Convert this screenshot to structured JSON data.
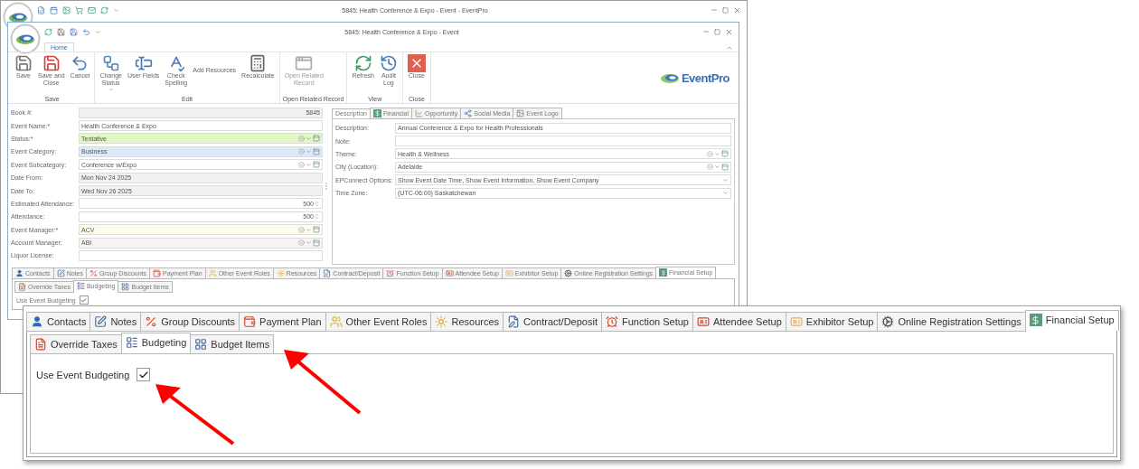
{
  "outer_window": {
    "title": "5845: Health Conference & Expo - Event - EventPro"
  },
  "event_window": {
    "title": "5845: Health Conference & Expo - Event",
    "ribbon_tabs": [
      {
        "label": "Home",
        "selected": true
      }
    ],
    "ribbon_groups": [
      {
        "label": "Save",
        "buttons": [
          {
            "label": "Save",
            "kind": "large",
            "disabled": false
          },
          {
            "label": "Save and\nClose",
            "kind": "large",
            "disabled": false
          },
          {
            "label": "Cancel",
            "kind": "large",
            "disabled": false
          }
        ]
      },
      {
        "label": "Edit",
        "buttons": [
          {
            "label": "Change\nStatus",
            "kind": "large",
            "disabled": false,
            "dropdown": true
          },
          {
            "label": "User Fields",
            "kind": "large",
            "disabled": false
          },
          {
            "label": "Check\nSpelling",
            "kind": "large",
            "disabled": false
          },
          {
            "label": "Add Resources",
            "kind": "small",
            "disabled": false
          },
          {
            "label": "Recalculate",
            "kind": "large",
            "disabled": false
          }
        ]
      },
      {
        "label": "Open Related Record",
        "buttons": [
          {
            "label": "Open Related\nRecord",
            "kind": "large",
            "disabled": true
          }
        ]
      },
      {
        "label": "View",
        "buttons": [
          {
            "label": "Refresh",
            "kind": "large",
            "disabled": false
          },
          {
            "label": "Audit\nLog",
            "kind": "large",
            "disabled": false
          }
        ]
      },
      {
        "label": "Close",
        "buttons": [
          {
            "label": "Close",
            "kind": "large",
            "disabled": false
          }
        ]
      }
    ],
    "brand": "EventPro",
    "fields": [
      {
        "label": "Book #:",
        "value": "5845",
        "kind": "id"
      },
      {
        "label": "Event Name:*",
        "value": "Health Conference & Expo",
        "kind": "text"
      },
      {
        "label": "Status:*",
        "value": "Tentative",
        "kind": "lookup",
        "color": "#e3f7c4"
      },
      {
        "label": "Event Category:",
        "value": "Business",
        "kind": "lookup",
        "color": "#dde9f8"
      },
      {
        "label": "Event Subcategory:",
        "value": "Conference w/Expo",
        "kind": "lookup"
      },
      {
        "label": "Date From:",
        "value": "Mon Nov 24 2025",
        "kind": "readonly"
      },
      {
        "label": "Date To:",
        "value": "Wed Nov 26 2025",
        "kind": "readonly"
      },
      {
        "label": "Estimated Attendance:",
        "value": "500",
        "kind": "spin"
      },
      {
        "label": "Attendance:",
        "value": "500",
        "kind": "spin"
      },
      {
        "label": "Event Manager:*",
        "value": "ACV",
        "kind": "lookup",
        "color": "#fdfbea"
      },
      {
        "label": "Account Manager:",
        "value": "ABI",
        "kind": "lookup",
        "color": "#fbf3f3"
      },
      {
        "label": "Liquor License:",
        "kind": "text"
      }
    ],
    "detail_tabs": [
      {
        "label": "Description",
        "selected": true
      },
      {
        "label": "Financial",
        "selected": false
      },
      {
        "label": "Opportunity",
        "selected": false
      },
      {
        "label": "Social Media",
        "selected": false
      },
      {
        "label": "Event Logo",
        "selected": false
      }
    ],
    "detail_fields": [
      {
        "label": "Description:",
        "value": "Annual Conference & Expo for Health Professionals",
        "kind": "text"
      },
      {
        "label": "Note:",
        "kind": "text"
      },
      {
        "label": "Theme:",
        "value": "Health & Wellness",
        "kind": "lookup"
      },
      {
        "label": "City (Location):",
        "value": "Adelaide",
        "kind": "lookup"
      },
      {
        "label": "EPConnect Options:",
        "value": "Show Event Date Time, Show Event Information, Show Event Company",
        "kind": "combo"
      },
      {
        "label": "Time Zone:",
        "value": "(UTC-06:00) Saskatchewan",
        "kind": "combo"
      }
    ],
    "section_tabs": [
      {
        "label": "Contacts",
        "selected": false
      },
      {
        "label": "Notes",
        "selected": false
      },
      {
        "label": "Group Discounts",
        "selected": false
      },
      {
        "label": "Payment Plan",
        "selected": false
      },
      {
        "label": "Other Event Roles",
        "selected": false
      },
      {
        "label": "Resources",
        "selected": false
      },
      {
        "label": "Contract/Deposit",
        "selected": false
      },
      {
        "label": "Function Setup",
        "selected": false
      },
      {
        "label": "Attendee Setup",
        "selected": false
      },
      {
        "label": "Exhibitor Setup",
        "selected": false
      },
      {
        "label": "Online Registration Settings",
        "selected": false
      },
      {
        "label": "Financial Setup",
        "selected": true
      }
    ],
    "sub_tabs": [
      {
        "label": "Override Taxes",
        "selected": false
      },
      {
        "label": "Budgeting",
        "selected": true
      },
      {
        "label": "Budget Items",
        "selected": false
      }
    ],
    "use_event_budgeting": {
      "label": "Use Event Budgeting",
      "checked": true
    }
  },
  "callout": {
    "section_tabs": [
      {
        "label": "Contacts",
        "selected": false
      },
      {
        "label": "Notes",
        "selected": false
      },
      {
        "label": "Group Discounts",
        "selected": false
      },
      {
        "label": "Payment Plan",
        "selected": false
      },
      {
        "label": "Other Event Roles",
        "selected": false
      },
      {
        "label": "Resources",
        "selected": false
      },
      {
        "label": "Contract/Deposit",
        "selected": false
      },
      {
        "label": "Function Setup",
        "selected": false
      },
      {
        "label": "Attendee Setup",
        "selected": false
      },
      {
        "label": "Exhibitor Setup",
        "selected": false
      },
      {
        "label": "Online Registration Settings",
        "selected": false
      },
      {
        "label": "Financial Setup",
        "selected": true
      }
    ],
    "sub_tabs": [
      {
        "label": "Override Taxes",
        "selected": false
      },
      {
        "label": "Budgeting",
        "selected": true
      },
      {
        "label": "Budget Items",
        "selected": false
      }
    ],
    "use_event_budgeting": {
      "label": "Use Event Budgeting",
      "checked": true
    }
  }
}
